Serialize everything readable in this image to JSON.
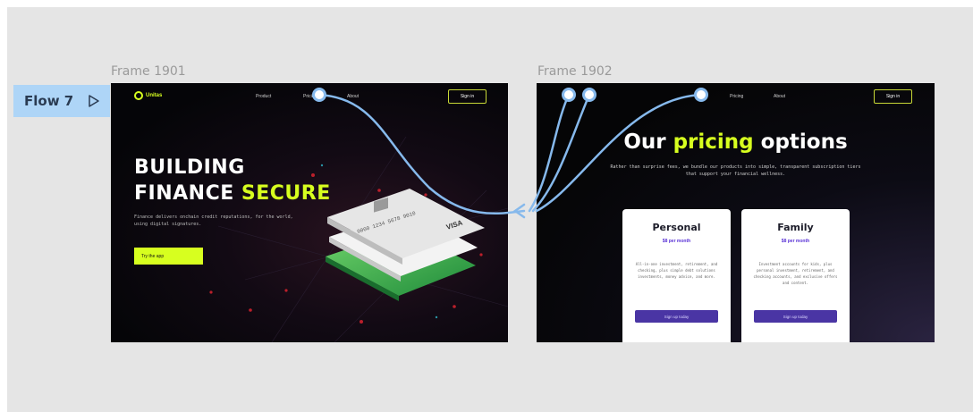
{
  "flow": {
    "label": "Flow 7",
    "icon": "play-outline-icon"
  },
  "frame1": {
    "label": "Frame 1901",
    "logo": "Unitas",
    "nav": [
      "Product",
      "Pricing",
      "About"
    ],
    "signin": "Sign in",
    "title_line1": "BUILDING",
    "title_line2_a": "FINANCE ",
    "title_line2_b": "SECURE",
    "subtitle": "Finance delivers onchain credit reputations, for the world, using digital signatures.",
    "cta": "Try the app",
    "card_brand": "VISA",
    "card_number": "0000 1234 5678 9010"
  },
  "frame2": {
    "label": "Frame 1902",
    "nav": [
      "Pricing",
      "About"
    ],
    "signin": "Sign in",
    "title_a": "Our ",
    "title_b": "pricing",
    "title_c": " options",
    "subtitle": "Rather than surprise fees, we bundle our products into simple, transparent subscription tiers that support your financial wellness.",
    "plans": [
      {
        "name": "Personal",
        "price": "$8 per month",
        "desc": "All-in-one investment, retirement, and checking, plus simple debt solutions investments, money advice, and more.",
        "button": "Sign up today"
      },
      {
        "name": "Family",
        "price": "$8 per month",
        "desc": "Investment accounts for kids, plus personal investment, retirement, and checking accounts, and exclusive offers and content.",
        "button": "Sign up today"
      }
    ]
  },
  "colors": {
    "canvas": "#e5e5e5",
    "accent": "#d7ff1f",
    "flow": "#aed5f7",
    "connector": "#86b9ec",
    "purple": "#4a35a4"
  }
}
